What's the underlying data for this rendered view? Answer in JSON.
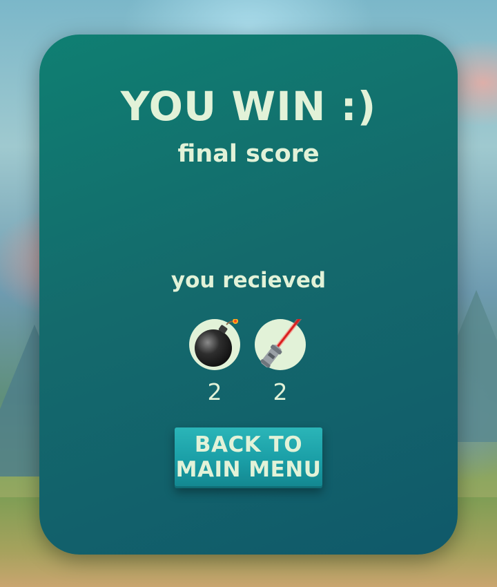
{
  "result": {
    "title": "YOU WIN :)",
    "subtitle": "final score",
    "received_label": "you recieved"
  },
  "rewards": [
    {
      "icon": "bomb-icon",
      "count": "2"
    },
    {
      "icon": "lightsaber-icon",
      "count": "2"
    }
  ],
  "back_button": {
    "line1": "BACK TO",
    "line2": "MAIN MENU"
  },
  "colors": {
    "panel": "#146a6c",
    "text": "#e2f2d8",
    "button": "#1a9ea6"
  }
}
